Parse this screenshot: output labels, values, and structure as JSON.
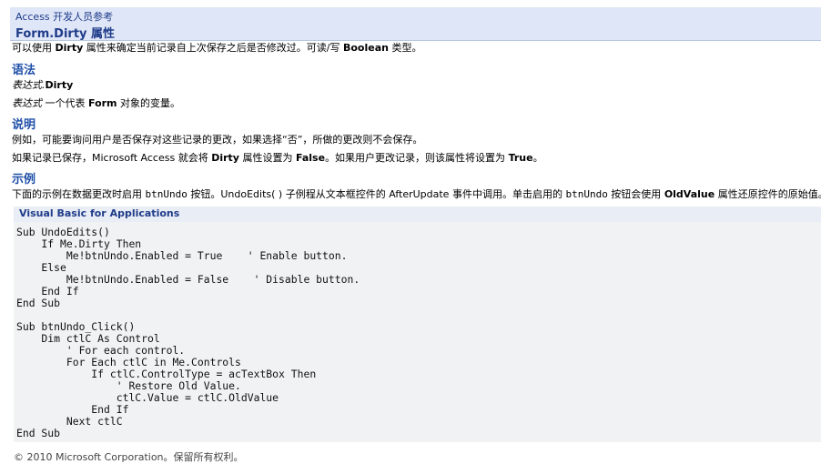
{
  "header": {
    "product": "Access 开发人员参考",
    "title": "Form.Dirty 属性"
  },
  "intro": {
    "a": "可以使用 ",
    "b": "Dirty",
    "c": " 属性来确定当前记录自上次保存之后是否修改过。可读/写 ",
    "d": "Boolean",
    "e": " 类型。"
  },
  "syntax": {
    "heading": "语法",
    "expr_prefix": "表达式.",
    "expr_prop": "Dirty",
    "param_name": "表达式",
    "param_desc_a": "  一个代表 ",
    "param_desc_b": "Form",
    "param_desc_c": " 对象的变量。"
  },
  "remarks": {
    "heading": "说明",
    "line1": "例如，可能要询问用户是否保存对这些记录的更改，如果选择“否”，所做的更改则不会保存。",
    "line2_a": "如果记录已保存，Microsoft Access 就会将 ",
    "line2_b": "Dirty",
    "line2_c": " 属性设置为 ",
    "line2_d": "False",
    "line2_e": "。如果用户更改记录，则该属性将设置为 ",
    "line2_f": "True",
    "line2_g": "。"
  },
  "example": {
    "heading": "示例",
    "desc_a": "下面的示例在数据更改时启用 ",
    "desc_b": "btnUndo",
    "desc_c": " 按钮。UndoEdits( ) 子例程从文本框控件的 AfterUpdate 事件中调用。单击启用的 ",
    "desc_d": "btnUndo",
    "desc_e": " 按钮会使用 ",
    "desc_f": "OldValue",
    "desc_g": " 属性还原控件的原始值。",
    "code_label": "Visual Basic for Applications",
    "code": "Sub UndoEdits()\n    If Me.Dirty Then\n        Me!btnUndo.Enabled = True    ' Enable button.\n    Else\n        Me!btnUndo.Enabled = False    ' Disable button.\n    End If\nEnd Sub\n\nSub btnUndo_Click()\n    Dim ctlC As Control\n        ' For each control.\n        For Each ctlC in Me.Controls\n            If ctlC.ControlType = acTextBox Then\n                ' Restore Old Value.\n                ctlC.Value = ctlC.OldValue\n            End If\n        Next ctlC\nEnd Sub"
  },
  "footer": "© 2010 Microsoft Corporation。保留所有权利。"
}
